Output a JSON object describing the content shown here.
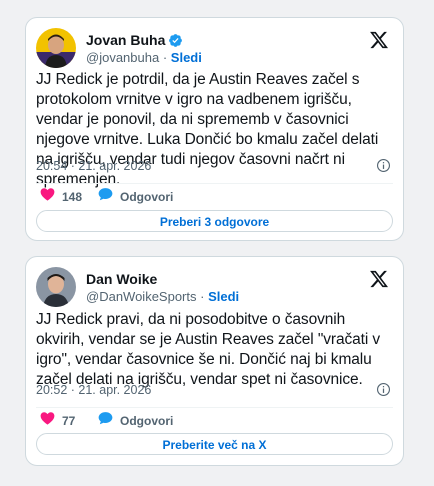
{
  "colors": {
    "background": "#f0f1f3",
    "link_blue": "#006fd6",
    "like_pink": "#f91880",
    "reply_blue": "#1d9bf0",
    "verified_blue": "#1d9bf0"
  },
  "tweets": [
    {
      "author": "Jovan Buha",
      "verified": true,
      "handle": "@jovanbuha",
      "separator": "·",
      "follow": "Sledi",
      "text": "JJ Redick je potrdil, da je Austin Reaves začel s protokolom vrnitve v igro na vadbenem igrišču, vendar je ponovil, da ni sprememb v časovnici njegove vrnitve. Luka Dončić bo kmalu začel delati na igrišču, vendar tudi njegov časovni načrt ni spremenjen.",
      "time": "20:54 · 21. apr. 2026",
      "likes": "148",
      "reply_label": "Odgovori",
      "pill_label": "Preberi 3 odgovore",
      "icons": [
        "verified-badge-icon",
        "x-logo-icon",
        "info-icon",
        "heart-icon",
        "reply-bubble-icon"
      ]
    },
    {
      "author": "Dan Woike",
      "verified": false,
      "handle": "@DanWoikeSports",
      "separator": "·",
      "follow": "Sledi",
      "text": "JJ Redick pravi, da ni posodobitve o časovnih okvirih, vendar se je Austin Reaves začel \"vračati v igro\", vendar časovnice še ni. Dončić naj bi kmalu začel delati na igrišču, vendar spet ni časovnice.",
      "time": "20:52 · 21. apr. 2026",
      "likes": "77",
      "reply_label": "Odgovori",
      "pill_label": "Preberite več na X",
      "icons": [
        "x-logo-icon",
        "info-icon",
        "heart-icon",
        "reply-bubble-icon"
      ]
    }
  ]
}
